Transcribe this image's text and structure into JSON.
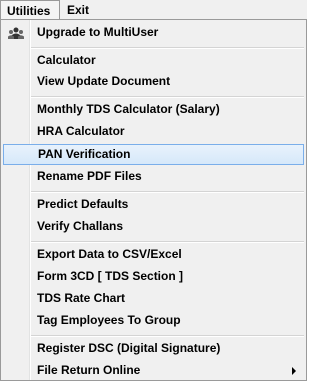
{
  "menubar": {
    "utilities": "Utilities",
    "exit": "Exit"
  },
  "menu": {
    "upgrade": "Upgrade to MultiUser",
    "calculator": "Calculator",
    "view_update_document": "View Update Document",
    "monthly_tds": "Monthly TDS Calculator (Salary)",
    "hra_calculator": "HRA Calculator",
    "pan_verification": "PAN Verification",
    "rename_pdf": "Rename PDF Files",
    "predict_defaults": "Predict Defaults",
    "verify_challans": "Verify Challans",
    "export_csv": "Export Data to CSV/Excel",
    "form_3cd": "Form 3CD [ TDS Section ]",
    "tds_rate_chart": "TDS Rate Chart",
    "tag_employees": "Tag Employees To Group",
    "register_dsc": "Register DSC (Digital Signature)",
    "file_return_online": "File Return Online"
  },
  "icons": {
    "upgrade": "users-group-icon",
    "file_return_online": "chevron-right-icon"
  },
  "colors": {
    "highlight_border": "#7aaeea",
    "highlight_fill": "#d6e8fa",
    "menu_bg": "#f0f0f0"
  }
}
